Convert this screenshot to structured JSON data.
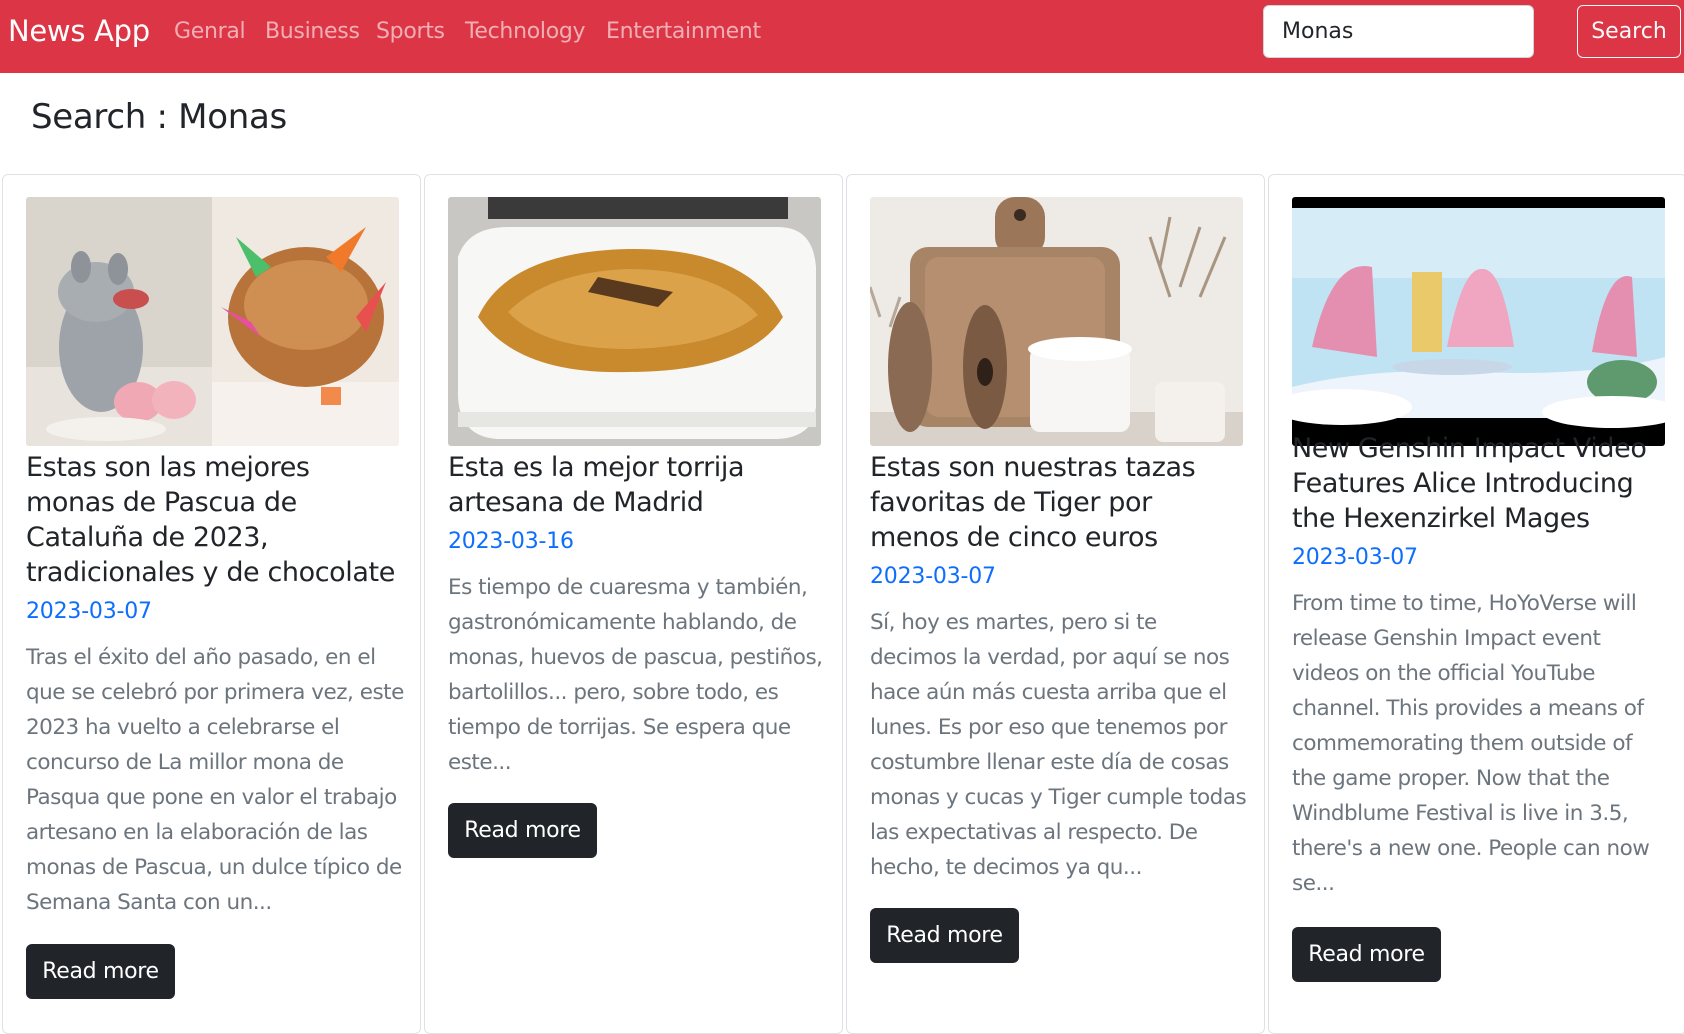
{
  "nav": {
    "brand": "News App",
    "links": [
      "Genral",
      "Business",
      "Sports",
      "Technology",
      "Entertainment"
    ],
    "search_value": "Monas",
    "search_button": "Search"
  },
  "page": {
    "title": "Search : Monas"
  },
  "articles": [
    {
      "title": "Estas son las mejores monas de Pascua de Cataluña de 2023, tradicionales y de chocolate",
      "date": "2023-03-07",
      "description": "Tras el éxito del año pasado, en el que se celebró por primera vez, este 2023 ha vuelto a celebrarse el concurso de La millor mona de Pasqua que pone en valor el trabajo artesano en la elaboración de las monas de Pascua, un dulce típico de Semana Santa con un...",
      "button": "Read more"
    },
    {
      "title": "Esta es la mejor torrija artesana de Madrid",
      "date": "2023-03-16",
      "description": "Es tiempo de cuaresma y también, gastronómicamente hablando, de monas, huevos de pascua, pestiños, bartolillos... pero, sobre todo, es tiempo de torrijas. Se espera que este...",
      "button": "Read more"
    },
    {
      "title": "Estas son nuestras tazas favoritas de Tiger por menos de cinco euros",
      "date": "2023-03-07",
      "description": "Sí, hoy es martes, pero si te decimos la verdad, por aquí se nos hace aún más cuesta arriba que el lunes. Es por eso que tenemos por costumbre llenar este día de cosas monas y cucas y Tiger cumple todas las expectativas al respecto. De hecho, te decimos ya qu...",
      "button": "Read more"
    },
    {
      "title": "New Genshin Impact Video Features Alice Introducing the Hexenzirkel Mages",
      "date": "2023-03-07",
      "description": "From time to time, HoYoVerse will release Genshin Impact event videos on the official YouTube channel. This provides a means of commemorating them outside of the game proper. Now that the Windblume Festival is live in 3.5, there's a new one. People can now se...",
      "button": "Read more"
    }
  ]
}
